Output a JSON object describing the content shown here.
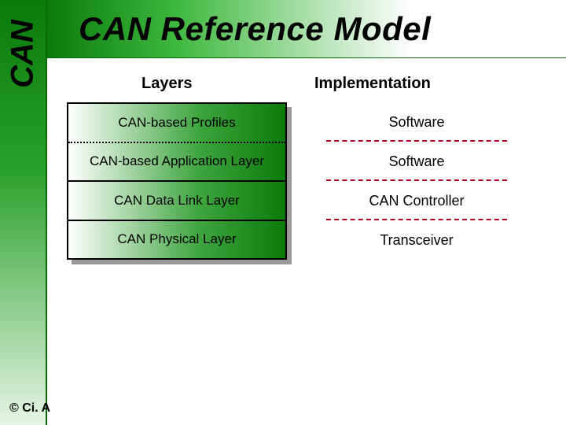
{
  "brand_label": "CAN",
  "title": "CAN Reference Model",
  "columns": {
    "layers_header": "Layers",
    "impl_header": "Implementation"
  },
  "layers": [
    {
      "name": "CAN-based Profiles",
      "impl": "Software"
    },
    {
      "name": "CAN-based Application Layer",
      "impl": "Software"
    },
    {
      "name": "CAN Data Link Layer",
      "impl": "CAN Controller"
    },
    {
      "name": "CAN Physical Layer",
      "impl": "Transceiver"
    }
  ],
  "footer": "© Ci. A",
  "colors": {
    "green_dark": "#0a7a0a",
    "green_light": "#3fb83f",
    "divider_red": "#b00020"
  }
}
